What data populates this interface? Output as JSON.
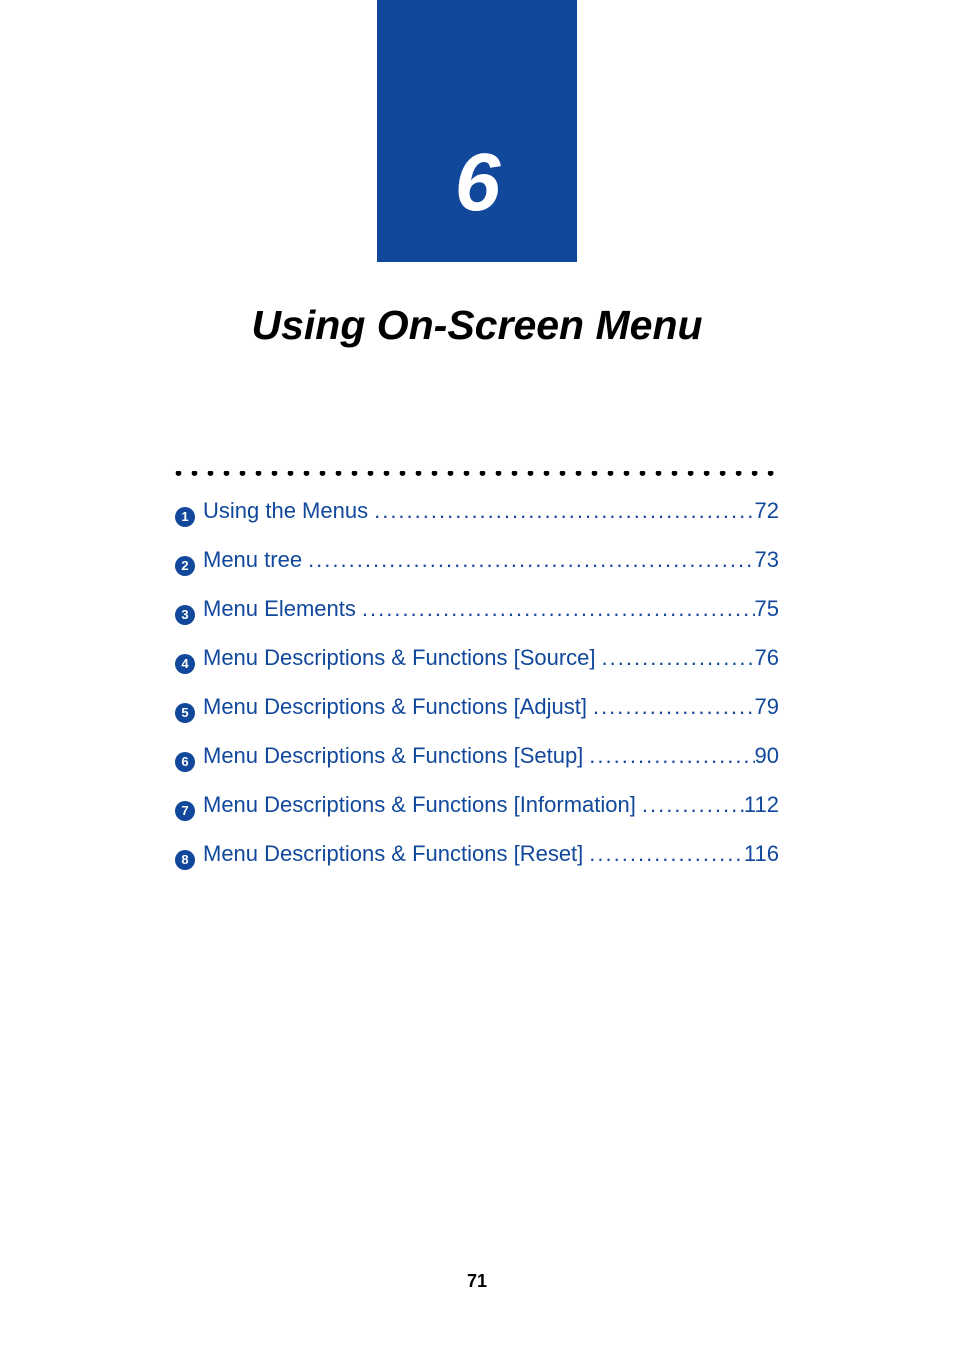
{
  "chapter": {
    "number": "6",
    "title": "Using On-Screen Menu"
  },
  "toc": {
    "items": [
      {
        "bullet": "1",
        "label": "Using the Menus",
        "page": "72"
      },
      {
        "bullet": "2",
        "label": "Menu tree",
        "page": "73"
      },
      {
        "bullet": "3",
        "label": "Menu Elements",
        "page": "75"
      },
      {
        "bullet": "4",
        "label": "Menu Descriptions & Functions [Source]",
        "page": "76"
      },
      {
        "bullet": "5",
        "label": "Menu Descriptions & Functions [Adjust]",
        "page": "79"
      },
      {
        "bullet": "6",
        "label": "Menu Descriptions & Functions [Setup]",
        "page": "90"
      },
      {
        "bullet": "7",
        "label": "Menu Descriptions & Functions [Information]",
        "page": "112"
      },
      {
        "bullet": "8",
        "label": "Menu Descriptions & Functions [Reset]",
        "page": "116"
      }
    ]
  },
  "page_number": "71",
  "dots": "•••••••••••••••••••••••••••••••••••••••••",
  "leader": "..........................................................................................................................."
}
